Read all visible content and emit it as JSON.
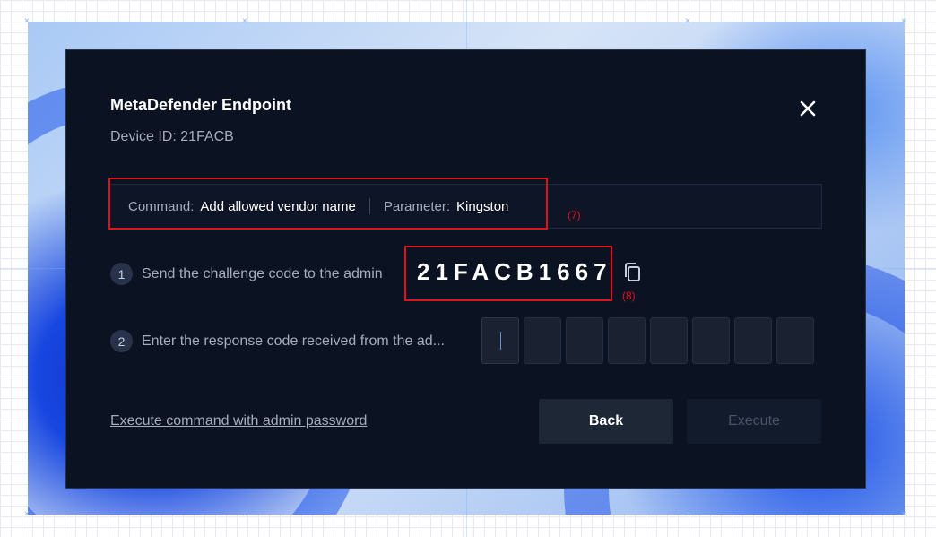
{
  "dialog": {
    "title": "MetaDefender Endpoint",
    "device_id": "Device ID: 21FACB",
    "close_icon": "close-icon"
  },
  "command": {
    "command_label": "Command:",
    "command_value": "Add allowed vendor name",
    "parameter_label": "Parameter:",
    "parameter_value": "Kingston"
  },
  "annotations": {
    "label_7": "(7)",
    "label_8": "(8)",
    "color": "#e0121a"
  },
  "steps": [
    {
      "number": "1",
      "text": "Send the challenge code to the admin"
    },
    {
      "number": "2",
      "text": "Enter the response code received from the ad..."
    }
  ],
  "challenge_code": "21FACB1667",
  "copy_icon": "copy-icon",
  "response_code": {
    "digits": [
      "",
      "",
      "",
      "",
      "",
      "",
      "",
      ""
    ]
  },
  "footer": {
    "admin_password_link": "Execute command with admin password",
    "back_button": "Back",
    "execute_button": "Execute"
  }
}
